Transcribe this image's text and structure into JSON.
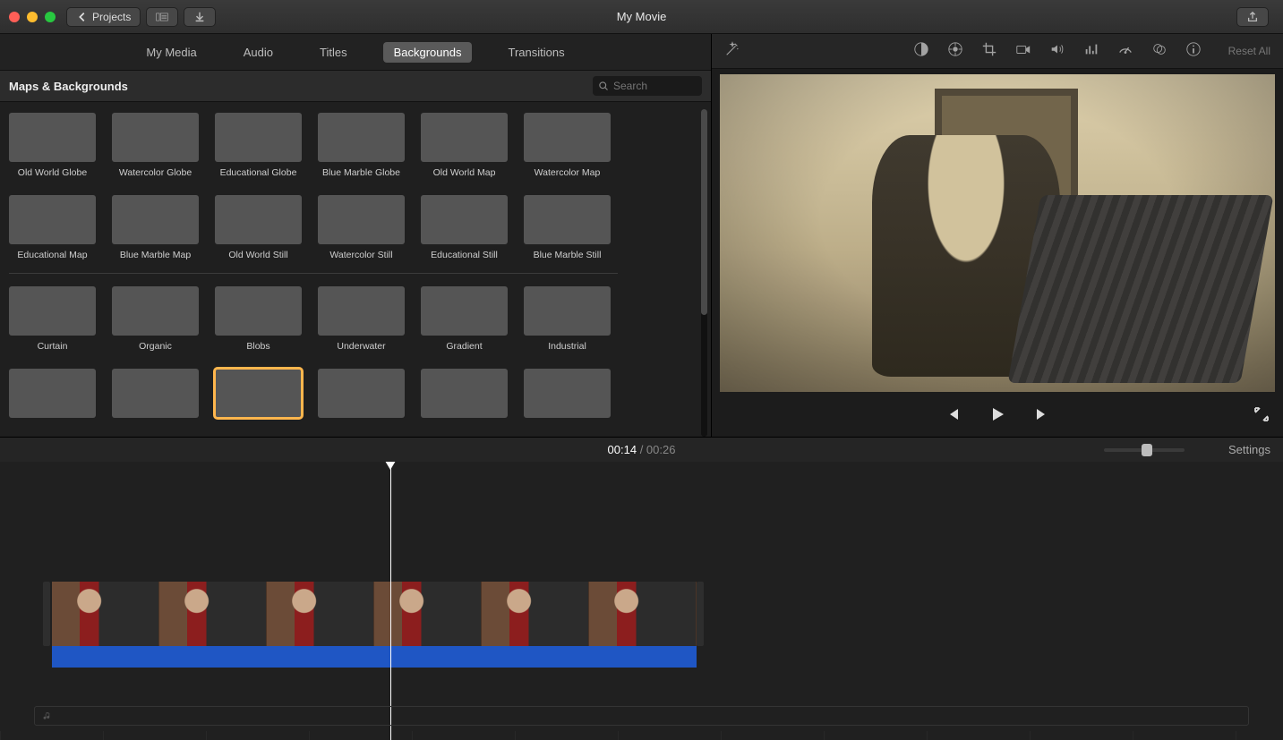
{
  "title": "My Movie",
  "projects_label": "Projects",
  "tabs": [
    "My Media",
    "Audio",
    "Titles",
    "Backgrounds",
    "Transitions"
  ],
  "active_tab": "Backgrounds",
  "subheader": "Maps & Backgrounds",
  "search_placeholder": "Search",
  "maps": [
    {
      "label": "Old World Globe",
      "cls": "globe"
    },
    {
      "label": "Watercolor Globe",
      "cls": "wcglobe"
    },
    {
      "label": "Educational Globe",
      "cls": "eduglobe"
    },
    {
      "label": "Blue Marble Globe",
      "cls": "bmglobe"
    },
    {
      "label": "Old World Map",
      "cls": "owmap"
    },
    {
      "label": "Watercolor Map",
      "cls": "wcmap"
    },
    {
      "label": "Educational Map",
      "cls": "edumap"
    },
    {
      "label": "Blue Marble Map",
      "cls": "bmmap"
    },
    {
      "label": "Old World Still",
      "cls": "owstill"
    },
    {
      "label": "Watercolor Still",
      "cls": "wcstill"
    },
    {
      "label": "Educational Still",
      "cls": "edustill"
    },
    {
      "label": "Blue Marble Still",
      "cls": "bmstill"
    }
  ],
  "backgrounds_row1": [
    {
      "label": "Curtain",
      "cls": "curtain"
    },
    {
      "label": "Organic",
      "cls": "organic"
    },
    {
      "label": "Blobs",
      "cls": "blobs"
    },
    {
      "label": "Underwater",
      "cls": "underwater"
    },
    {
      "label": "Gradient",
      "cls": "gradient"
    },
    {
      "label": "Industrial",
      "cls": "industrial"
    }
  ],
  "backgrounds_row2": [
    {
      "label": "",
      "cls": "bg1"
    },
    {
      "label": "",
      "cls": "bg2"
    },
    {
      "label": "",
      "cls": "bg3",
      "selected": true
    },
    {
      "label": "",
      "cls": "bg4"
    },
    {
      "label": "",
      "cls": "bg5"
    },
    {
      "label": "",
      "cls": "bg6"
    }
  ],
  "reset_all": "Reset All",
  "time_current": "00:14",
  "time_total": "00:26",
  "settings_label": "Settings",
  "adjust_icons": [
    "wand-icon",
    "balance-icon",
    "color-wheel-icon",
    "crop-icon",
    "camera-icon",
    "volume-icon",
    "eq-icon",
    "speed-icon",
    "effects-icon",
    "info-icon"
  ]
}
